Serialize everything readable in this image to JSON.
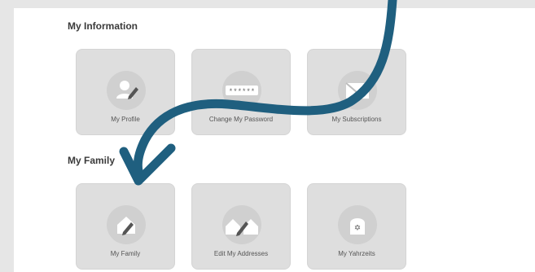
{
  "sections": {
    "information": {
      "title": "My Information",
      "tiles": [
        {
          "label": "My Profile",
          "icon": "profile-edit-icon"
        },
        {
          "label": "Change My Password",
          "icon": "password-dots-icon"
        },
        {
          "label": "My Subscriptions",
          "icon": "envelope-icon"
        }
      ]
    },
    "family": {
      "title": "My Family",
      "tiles": [
        {
          "label": "My Family",
          "icon": "home-edit-icon"
        },
        {
          "label": "Edit My Addresses",
          "icon": "houses-edit-icon"
        },
        {
          "label": "My Yahrzeits",
          "icon": "star-stone-icon"
        }
      ]
    }
  },
  "password_mask": "******",
  "colors": {
    "page_bg": "#e6e6e6",
    "panel_bg": "#ffffff",
    "tile_bg": "#dedede",
    "icon_circle": "#d0d0d0",
    "icon_glyph": "#ffffff",
    "arrow": "#1f5f7f"
  }
}
